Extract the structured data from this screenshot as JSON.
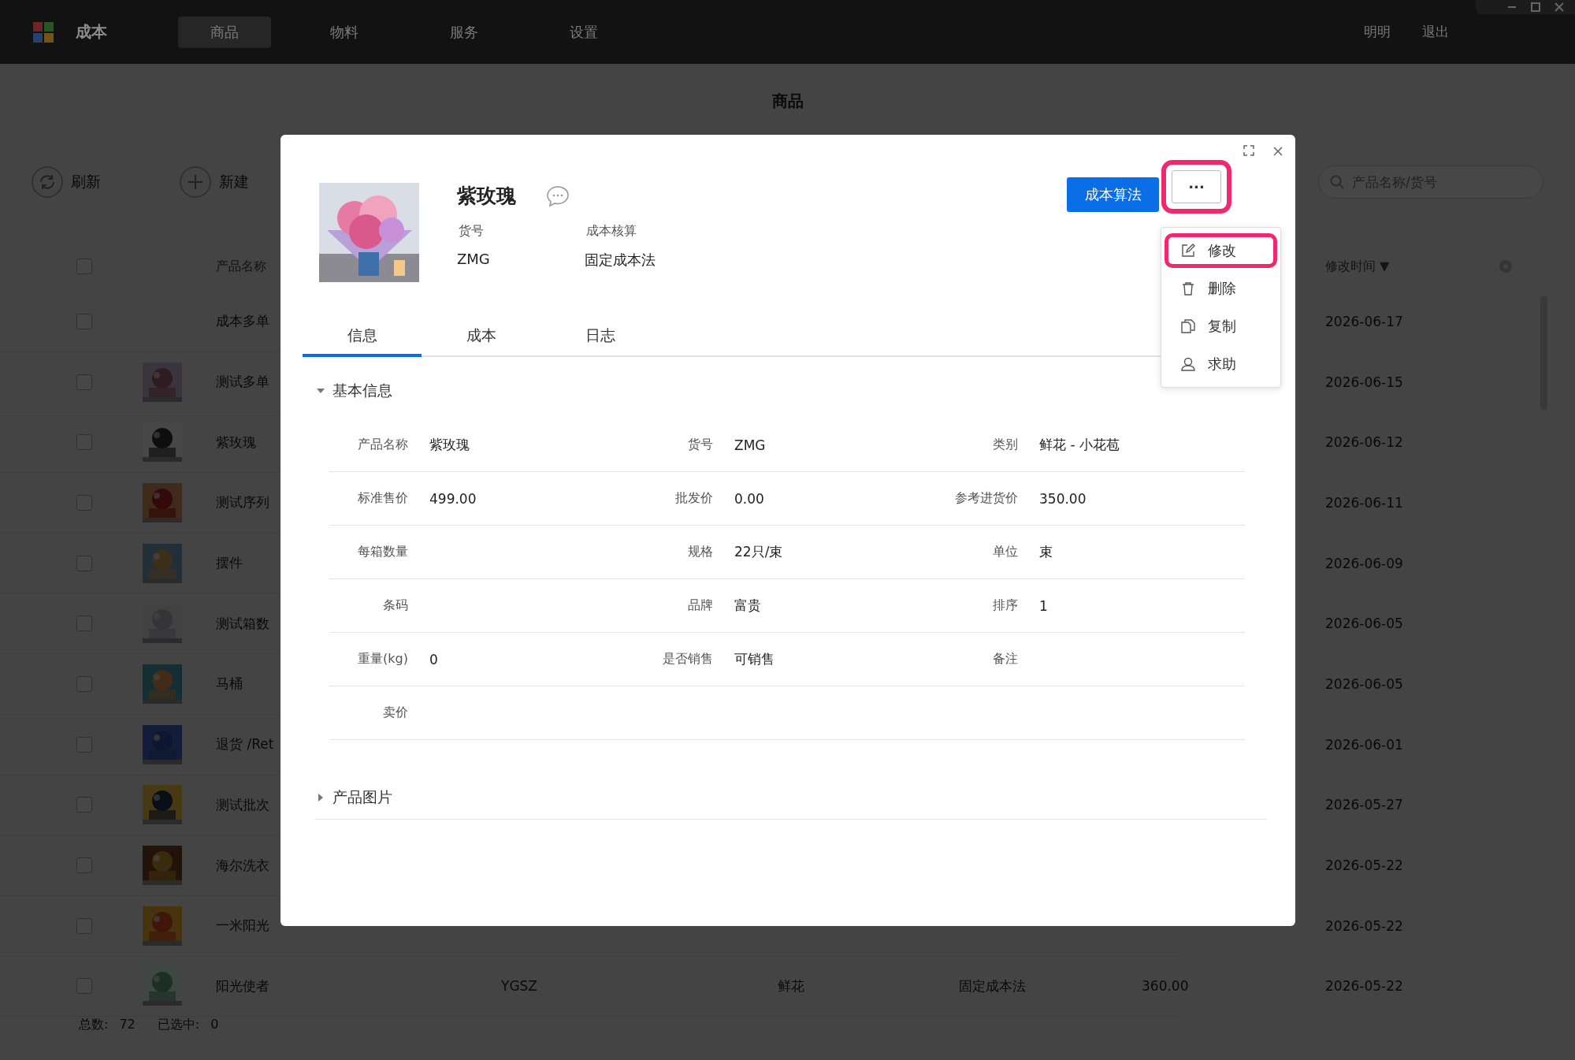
{
  "app": {
    "title": "成本",
    "nav": [
      {
        "label": "商品",
        "selected": true
      },
      {
        "label": "物料",
        "selected": false
      },
      {
        "label": "服务",
        "selected": false
      },
      {
        "label": "设置",
        "selected": false
      }
    ],
    "user_links": [
      "明明",
      "退出"
    ]
  },
  "page": {
    "title": "商品",
    "toolbar": [
      {
        "label": "刷新",
        "kind": "refresh"
      },
      {
        "label": "新建",
        "kind": "add"
      }
    ],
    "search": {
      "placeholder": "产品名称/货号"
    }
  },
  "table": {
    "columns": {
      "all_checked": false,
      "name": "产品名称",
      "modified": "修改时间",
      "sort": "▼"
    },
    "rows": [
      {
        "checked": false,
        "thumbnail": false,
        "name": "成本多单",
        "modified": "2026-06-17"
      },
      {
        "checked": false,
        "thumbnail": true,
        "name": "测试多单",
        "modified": "2026-06-15"
      },
      {
        "checked": false,
        "thumbnail": true,
        "name": "紫玫瑰",
        "modified": "2026-06-12"
      },
      {
        "checked": false,
        "thumbnail": true,
        "name": "测试序列",
        "modified": "2026-06-11"
      },
      {
        "checked": false,
        "thumbnail": true,
        "name": "摆件",
        "modified": "2026-06-09"
      },
      {
        "checked": false,
        "thumbnail": true,
        "name": "测试箱数",
        "modified": "2026-06-05"
      },
      {
        "checked": false,
        "thumbnail": true,
        "name": "马桶",
        "modified": "2026-06-05"
      },
      {
        "checked": false,
        "thumbnail": true,
        "name": "退货 /Ret",
        "modified": "2026-06-01"
      },
      {
        "checked": false,
        "thumbnail": true,
        "name": "测试批次",
        "modified": "2026-05-27"
      },
      {
        "checked": false,
        "thumbnail": true,
        "name": "海尔洗衣",
        "modified": "2026-05-22"
      },
      {
        "checked": false,
        "thumbnail": true,
        "name": "一米阳光",
        "modified": "2026-05-22"
      },
      {
        "checked": false,
        "thumbnail": true,
        "name": "阳光使者",
        "code": "YGSZ",
        "category": "鲜花",
        "costing": "固定成本法",
        "price": "360.00",
        "modified": "2026-05-22"
      }
    ],
    "footer": {
      "total_label": "总数:",
      "total": "72",
      "selected_label": "已选中:",
      "selected": "0"
    }
  },
  "dialog": {
    "product": {
      "name": "紫玫瑰",
      "fields": [
        {
          "label": "货号",
          "value": "ZMG"
        },
        {
          "label": "成本核算",
          "value": "固定成本法"
        }
      ]
    },
    "primary_button": "成本算法",
    "more_button": {
      "label": "···",
      "highlighted": true
    },
    "menu": [
      {
        "label": "修改",
        "kind": "edit",
        "highlighted": true
      },
      {
        "label": "删除",
        "kind": "delete",
        "highlighted": false
      },
      {
        "label": "复制",
        "kind": "copy",
        "highlighted": false
      },
      {
        "label": "求助",
        "kind": "help",
        "highlighted": false
      }
    ],
    "tabs": [
      {
        "label": "信息",
        "selected": true
      },
      {
        "label": "成本",
        "selected": false
      },
      {
        "label": "日志",
        "selected": false
      }
    ],
    "sections": [
      {
        "title": "基本信息",
        "expanded": true,
        "rows": [
          [
            {
              "label": "产品名称",
              "value": "紫玫瑰"
            },
            {
              "label": "货号",
              "value": "ZMG"
            },
            {
              "label": "类别",
              "value": "鲜花 - 小花苞"
            }
          ],
          [
            {
              "label": "标准售价",
              "value": "499.00"
            },
            {
              "label": "批发价",
              "value": "0.00"
            },
            {
              "label": "参考进货价",
              "value": "350.00"
            }
          ],
          [
            {
              "label": "每箱数量"
            },
            {
              "label": "规格",
              "value": "22只/束"
            },
            {
              "label": "单位",
              "value": "束"
            }
          ],
          [
            {
              "label": "条码"
            },
            {
              "label": "品牌",
              "value": "富贵"
            },
            {
              "label": "排序",
              "value": "1"
            }
          ],
          [
            {
              "label": "重量(kg)",
              "value": "0"
            },
            {
              "label": "是否销售",
              "value": "可销售"
            },
            {
              "label": "备注"
            }
          ],
          [
            {
              "label": "卖价"
            }
          ]
        ]
      },
      {
        "title": "产品图片",
        "expanded": false
      }
    ]
  }
}
